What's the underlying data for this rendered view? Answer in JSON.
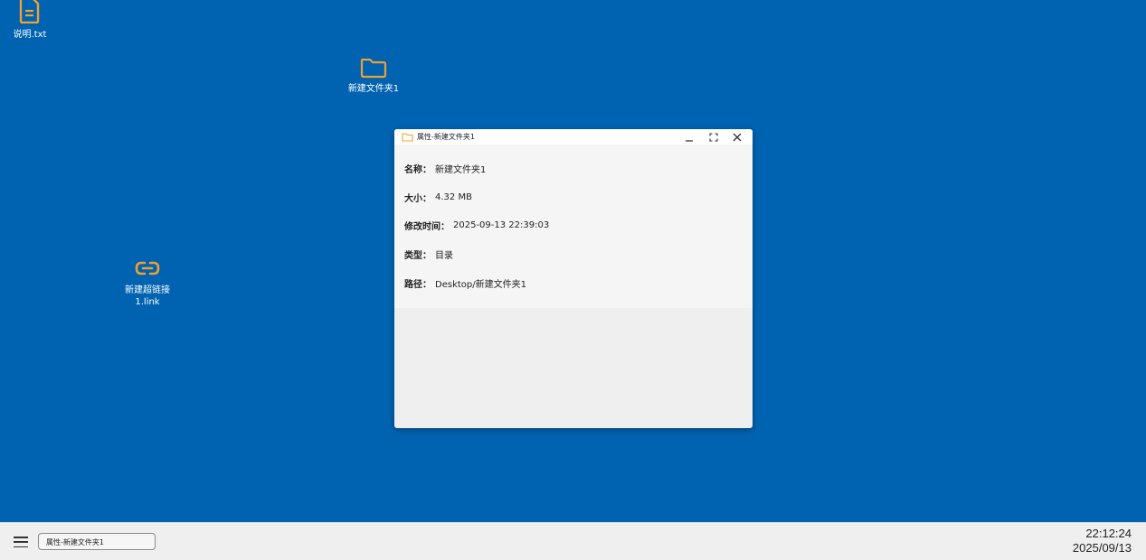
{
  "colors": {
    "desktop_bg": "#0063b1",
    "icon_accent": "#f0a030"
  },
  "desktop": {
    "icons": [
      {
        "name": "说明.txt",
        "icon": "text-file-icon"
      },
      {
        "name": "新建文件夹1",
        "icon": "folder-icon"
      },
      {
        "name_line1": "新建超链接",
        "name_line2": "1.link",
        "icon": "link-icon"
      }
    ]
  },
  "window": {
    "title": "属性-新建文件夹1",
    "icon": "folder-icon",
    "controls": [
      "minimize",
      "maximize",
      "close"
    ],
    "properties": [
      {
        "key": "名称：",
        "value": "新建文件夹1"
      },
      {
        "key": "大小：",
        "value": "4.32 MB"
      },
      {
        "key": "修改时间：",
        "value": "2025-09-13 22:39:03"
      },
      {
        "key": "类型：",
        "value": "目录"
      },
      {
        "key": "路径：",
        "value": "Desktop/新建文件夹1"
      }
    ]
  },
  "taskbar": {
    "menu_icon": "hamburger-menu-icon",
    "items": [
      {
        "label": "属性-新建文件夹1"
      }
    ],
    "clock": {
      "time": "22:12:24",
      "date": "2025/09/13"
    }
  }
}
